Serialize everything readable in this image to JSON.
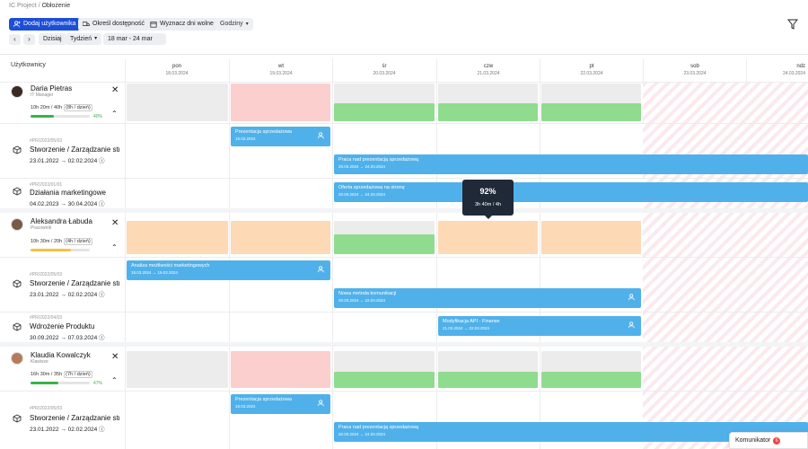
{
  "breadcrumb": {
    "project": "IC Project",
    "sep": "/",
    "current": "Obłożenie"
  },
  "toolbar": {
    "add_user": "Dodaj użytkownika",
    "availability": "Określ dostępność",
    "days_off": "Wyznacz dni wolne",
    "hours": "Godziny",
    "today": "Dzisiaj",
    "view": "Tydzień",
    "range": "18 mar - 24 mar"
  },
  "users_header": "Użytkownicy",
  "days": [
    {
      "name": "pon",
      "date": "18.03.2024"
    },
    {
      "name": "wt",
      "date": "19.03.2024"
    },
    {
      "name": "śr",
      "date": "20.03.2024"
    },
    {
      "name": "czw",
      "date": "21.03.2024"
    },
    {
      "name": "pt",
      "date": "22.03.2024"
    },
    {
      "name": "sob",
      "date": "23.03.2024"
    },
    {
      "name": "ndz",
      "date": "24.03.2024"
    }
  ],
  "people": [
    {
      "name": "Daria Pietras",
      "role": "IT Manager",
      "time": "10h 20m / 40h",
      "per_day": "(8h / dzień)",
      "pct": "40%",
      "progress": 0.4,
      "bar_color": "#3ab24a",
      "tasks": [
        {
          "code": "#PR/2022/05/03",
          "name": "Stworzenie / Zarządzanie str...",
          "start": "23.01.2022",
          "end": "02.02.2024"
        },
        {
          "code": "#PR/2022/01/01",
          "name": "Działania marketingowe",
          "start": "04.02.2023",
          "end": "30.04.2024"
        }
      ]
    },
    {
      "name": "Aleksandra Łabuda",
      "role": "Pracownik",
      "time": "10h 30m / 20h",
      "per_day": "(4h / dzień)",
      "pct": "",
      "progress": 0.68,
      "bar_color": "#f5c242",
      "tasks": [
        {
          "code": "#PR/2022/05/03",
          "name": "Stworzenie / Zarządzanie str...",
          "start": "23.01.2022",
          "end": "02.02.2024"
        },
        {
          "code": "#PR/2022/04/03",
          "name": "Wdrożenie Produktu",
          "start": "30.09.2022",
          "end": "07.03.2024"
        }
      ]
    },
    {
      "name": "Klaudia Kowalczyk",
      "role": "Klawisze",
      "time": "16h 30m / 35h",
      "per_day": "(7h / dzień)",
      "pct": "47%",
      "progress": 0.47,
      "bar_color": "#3ab24a",
      "tasks": [
        {
          "code": "#PR/2022/05/03",
          "name": "Stworzenie / Zarządzanie str...",
          "start": "23.01.2022",
          "end": "02.02.2024"
        }
      ]
    }
  ],
  "bars": [
    {
      "title": "Prezentacja sprzedażowa",
      "dates": "19.03.2024"
    },
    {
      "title": "Praca nad prezentacją sprzedażową",
      "dates": "20.03.2024 → 24.03.2024"
    },
    {
      "title": "Oferta sprzedażowa na stronę",
      "dates": "20.03.2024 → 24.03.2024"
    },
    {
      "title": "Analiza możliwości marketingowych",
      "dates": "18.03.2024 → 19.03.2024"
    },
    {
      "title": "Nowa metoda komunikacji",
      "dates": "20.03.2024 → 22.03.2024"
    },
    {
      "title": "Modyfikacja API - Finanse",
      "dates": "21.03.2024 → 22.03.2024"
    },
    {
      "title": "Prezentacja sprzedażowa",
      "dates": "19.03.2024"
    },
    {
      "title": "Praca nad prezentacją sprzedażową",
      "dates": "20.03.2024 → 24.03.2024"
    }
  ],
  "tooltip": {
    "pct": "92%",
    "time": "3h 40m / 4h"
  },
  "chat": {
    "label": "Komunikator",
    "count": "6"
  },
  "colors": {
    "accent": "#1d4ed8",
    "task_bar": "#50b1ea",
    "over": "#fccfcf",
    "ok": "#8fdc8f",
    "warn": "#fdd9b5",
    "empty": "#ececec"
  }
}
